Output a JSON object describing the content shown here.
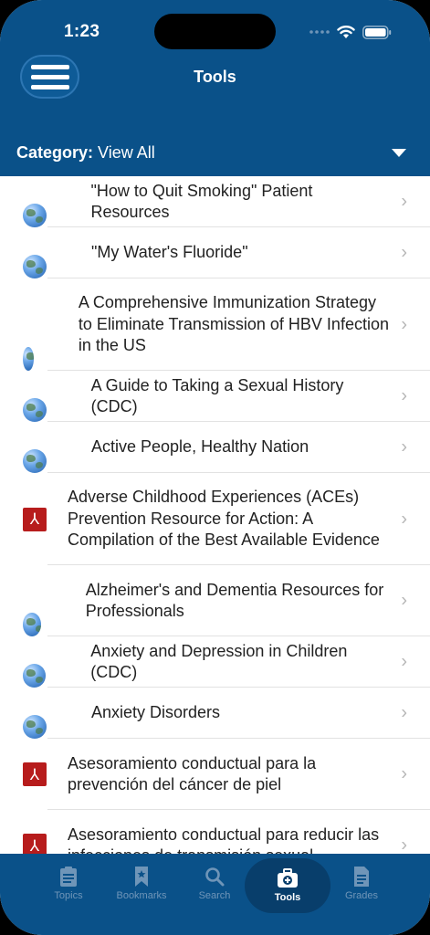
{
  "status_bar": {
    "time": "1:23"
  },
  "header": {
    "title": "Tools"
  },
  "category": {
    "label": "Category:",
    "value": "View All"
  },
  "items": [
    {
      "title": "\"How to Quit Smoking\" Patient Resources",
      "icon": "globe-icon"
    },
    {
      "title": "\"My Water's Fluoride\"",
      "icon": "globe-icon"
    },
    {
      "title": "A Comprehensive Immunization Strategy to Eliminate Transmission of HBV Infection in the US",
      "icon": "globe-icon"
    },
    {
      "title": "A Guide to Taking a Sexual History (CDC)",
      "icon": "globe-icon"
    },
    {
      "title": "Active People, Healthy Nation",
      "icon": "globe-icon"
    },
    {
      "title": "Adverse Childhood Experiences (ACEs) Prevention Resource for Action: A Compilation of the Best Available Evidence",
      "icon": "pdf-icon"
    },
    {
      "title": "Alzheimer's and Dementia Resources for Professionals",
      "icon": "globe-icon"
    },
    {
      "title": "Anxiety and Depression in Children (CDC)",
      "icon": "globe-icon"
    },
    {
      "title": "Anxiety Disorders",
      "icon": "globe-icon"
    },
    {
      "title": "Asesoramiento conductual para la prevención del cáncer de piel",
      "icon": "pdf-icon"
    },
    {
      "title": "Asesoramiento conductual para reducir las infecciones de transmisión sexual",
      "icon": "pdf-icon"
    }
  ],
  "tabs": [
    {
      "label": "Topics",
      "icon": "clipboard-icon"
    },
    {
      "label": "Bookmarks",
      "icon": "bookmark-icon"
    },
    {
      "label": "Search",
      "icon": "search-icon"
    },
    {
      "label": "Tools",
      "icon": "medical-kit-icon",
      "active": true
    },
    {
      "label": "Grades",
      "icon": "document-icon"
    }
  ],
  "colors": {
    "brand": "#0a5189",
    "active_tab": "#083e6b",
    "pdf_red": "#b71c1c"
  }
}
